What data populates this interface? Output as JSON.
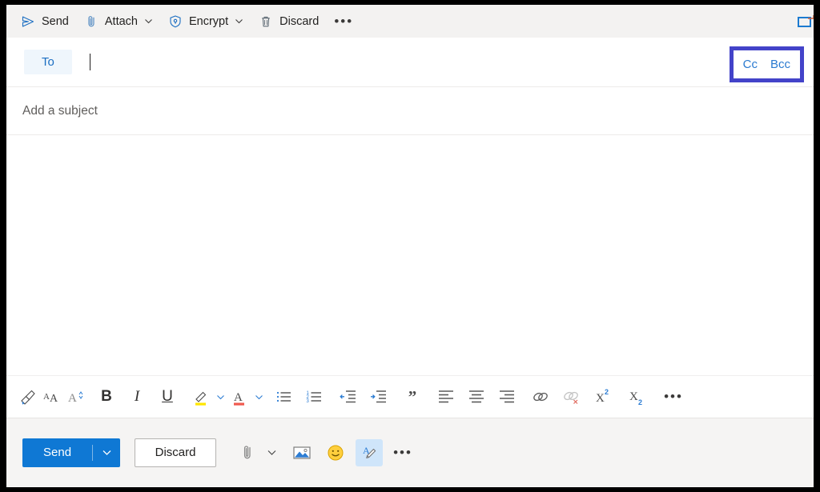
{
  "colors": {
    "accent": "#0f78d4",
    "annotation": "#4343c9",
    "link": "#2a7ad0",
    "toolbar_bg": "#f3f2f1",
    "action_bar_bg": "#f5f4f3",
    "highlight_yellow": "#ffe600",
    "font_color_red": "#f05a4f",
    "active_btn_bg": "#cfe5fa",
    "frame": "#000000"
  },
  "command_bar": {
    "items": [
      {
        "label": "Send",
        "icon": "send-icon",
        "has_chevron": false
      },
      {
        "label": "Attach",
        "icon": "paperclip-icon",
        "has_chevron": true
      },
      {
        "label": "Encrypt",
        "icon": "shield-lock-icon",
        "has_chevron": true
      },
      {
        "label": "Discard",
        "icon": "trash-icon",
        "has_chevron": false
      }
    ],
    "overflow_label": "•••",
    "popout_icon": "pop-out-icon"
  },
  "recipients": {
    "to_label": "To",
    "to_value": "",
    "cc_label": "Cc",
    "bcc_label": "Bcc"
  },
  "subject": {
    "placeholder": "Add a subject",
    "value": ""
  },
  "body": {
    "value": ""
  },
  "format_bar": {
    "items": [
      {
        "name": "format-painter",
        "icon": "paintbrush-icon"
      },
      {
        "name": "font-size",
        "icon": "font-size-icon"
      },
      {
        "name": "font-grow-shrink",
        "icon": "font-grow-icon"
      },
      {
        "name": "bold",
        "icon": "bold-icon",
        "text": "B"
      },
      {
        "name": "italic",
        "icon": "italic-icon",
        "text": "I"
      },
      {
        "name": "underline",
        "icon": "underline-icon",
        "text": "U"
      },
      {
        "name": "highlight",
        "icon": "highlighter-icon",
        "has_chevron": true
      },
      {
        "name": "font-color",
        "icon": "font-color-icon",
        "has_chevron": true
      },
      {
        "name": "bulleted-list",
        "icon": "bulleted-list-icon"
      },
      {
        "name": "numbered-list",
        "icon": "numbered-list-icon"
      },
      {
        "name": "decrease-indent",
        "icon": "decrease-indent-icon"
      },
      {
        "name": "increase-indent",
        "icon": "increase-indent-icon"
      },
      {
        "name": "quote",
        "icon": "quote-icon",
        "text": "”"
      },
      {
        "name": "align-left",
        "icon": "align-left-icon"
      },
      {
        "name": "align-center",
        "icon": "align-center-icon"
      },
      {
        "name": "align-right",
        "icon": "align-right-icon"
      },
      {
        "name": "insert-link",
        "icon": "link-icon"
      },
      {
        "name": "remove-link",
        "icon": "remove-link-icon"
      },
      {
        "name": "superscript",
        "icon": "superscript-icon"
      },
      {
        "name": "subscript",
        "icon": "subscript-icon"
      }
    ],
    "overflow_label": "•••"
  },
  "action_bar": {
    "send_label": "Send",
    "discard_label": "Discard",
    "overflow_label": "•••",
    "tools": [
      {
        "name": "attach-file",
        "icon": "paperclip-icon",
        "has_chevron": true,
        "active": false
      },
      {
        "name": "insert-picture",
        "icon": "picture-icon",
        "has_chevron": false,
        "active": false
      },
      {
        "name": "insert-emoji",
        "icon": "emoji-icon",
        "has_chevron": false,
        "active": false
      },
      {
        "name": "toggle-formatting-options",
        "icon": "formatting-pen-icon",
        "has_chevron": false,
        "active": true
      }
    ]
  }
}
